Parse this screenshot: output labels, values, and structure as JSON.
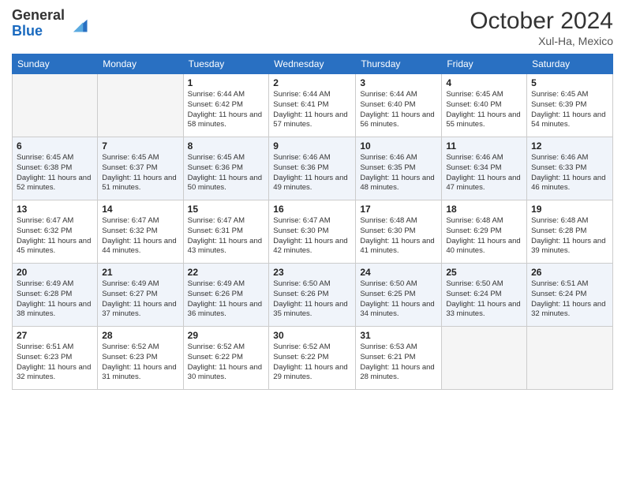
{
  "header": {
    "logo_line1": "General",
    "logo_line2": "Blue",
    "month": "October 2024",
    "location": "Xul-Ha, Mexico"
  },
  "weekdays": [
    "Sunday",
    "Monday",
    "Tuesday",
    "Wednesday",
    "Thursday",
    "Friday",
    "Saturday"
  ],
  "weeks": [
    [
      {
        "day": "",
        "sunrise": "",
        "sunset": "",
        "daylight": "",
        "empty": true
      },
      {
        "day": "",
        "sunrise": "",
        "sunset": "",
        "daylight": "",
        "empty": true
      },
      {
        "day": "1",
        "sunrise": "Sunrise: 6:44 AM",
        "sunset": "Sunset: 6:42 PM",
        "daylight": "Daylight: 11 hours and 58 minutes."
      },
      {
        "day": "2",
        "sunrise": "Sunrise: 6:44 AM",
        "sunset": "Sunset: 6:41 PM",
        "daylight": "Daylight: 11 hours and 57 minutes."
      },
      {
        "day": "3",
        "sunrise": "Sunrise: 6:44 AM",
        "sunset": "Sunset: 6:40 PM",
        "daylight": "Daylight: 11 hours and 56 minutes."
      },
      {
        "day": "4",
        "sunrise": "Sunrise: 6:45 AM",
        "sunset": "Sunset: 6:40 PM",
        "daylight": "Daylight: 11 hours and 55 minutes."
      },
      {
        "day": "5",
        "sunrise": "Sunrise: 6:45 AM",
        "sunset": "Sunset: 6:39 PM",
        "daylight": "Daylight: 11 hours and 54 minutes."
      }
    ],
    [
      {
        "day": "6",
        "sunrise": "Sunrise: 6:45 AM",
        "sunset": "Sunset: 6:38 PM",
        "daylight": "Daylight: 11 hours and 52 minutes."
      },
      {
        "day": "7",
        "sunrise": "Sunrise: 6:45 AM",
        "sunset": "Sunset: 6:37 PM",
        "daylight": "Daylight: 11 hours and 51 minutes."
      },
      {
        "day": "8",
        "sunrise": "Sunrise: 6:45 AM",
        "sunset": "Sunset: 6:36 PM",
        "daylight": "Daylight: 11 hours and 50 minutes."
      },
      {
        "day": "9",
        "sunrise": "Sunrise: 6:46 AM",
        "sunset": "Sunset: 6:36 PM",
        "daylight": "Daylight: 11 hours and 49 minutes."
      },
      {
        "day": "10",
        "sunrise": "Sunrise: 6:46 AM",
        "sunset": "Sunset: 6:35 PM",
        "daylight": "Daylight: 11 hours and 48 minutes."
      },
      {
        "day": "11",
        "sunrise": "Sunrise: 6:46 AM",
        "sunset": "Sunset: 6:34 PM",
        "daylight": "Daylight: 11 hours and 47 minutes."
      },
      {
        "day": "12",
        "sunrise": "Sunrise: 6:46 AM",
        "sunset": "Sunset: 6:33 PM",
        "daylight": "Daylight: 11 hours and 46 minutes."
      }
    ],
    [
      {
        "day": "13",
        "sunrise": "Sunrise: 6:47 AM",
        "sunset": "Sunset: 6:32 PM",
        "daylight": "Daylight: 11 hours and 45 minutes."
      },
      {
        "day": "14",
        "sunrise": "Sunrise: 6:47 AM",
        "sunset": "Sunset: 6:32 PM",
        "daylight": "Daylight: 11 hours and 44 minutes."
      },
      {
        "day": "15",
        "sunrise": "Sunrise: 6:47 AM",
        "sunset": "Sunset: 6:31 PM",
        "daylight": "Daylight: 11 hours and 43 minutes."
      },
      {
        "day": "16",
        "sunrise": "Sunrise: 6:47 AM",
        "sunset": "Sunset: 6:30 PM",
        "daylight": "Daylight: 11 hours and 42 minutes."
      },
      {
        "day": "17",
        "sunrise": "Sunrise: 6:48 AM",
        "sunset": "Sunset: 6:30 PM",
        "daylight": "Daylight: 11 hours and 41 minutes."
      },
      {
        "day": "18",
        "sunrise": "Sunrise: 6:48 AM",
        "sunset": "Sunset: 6:29 PM",
        "daylight": "Daylight: 11 hours and 40 minutes."
      },
      {
        "day": "19",
        "sunrise": "Sunrise: 6:48 AM",
        "sunset": "Sunset: 6:28 PM",
        "daylight": "Daylight: 11 hours and 39 minutes."
      }
    ],
    [
      {
        "day": "20",
        "sunrise": "Sunrise: 6:49 AM",
        "sunset": "Sunset: 6:28 PM",
        "daylight": "Daylight: 11 hours and 38 minutes."
      },
      {
        "day": "21",
        "sunrise": "Sunrise: 6:49 AM",
        "sunset": "Sunset: 6:27 PM",
        "daylight": "Daylight: 11 hours and 37 minutes."
      },
      {
        "day": "22",
        "sunrise": "Sunrise: 6:49 AM",
        "sunset": "Sunset: 6:26 PM",
        "daylight": "Daylight: 11 hours and 36 minutes."
      },
      {
        "day": "23",
        "sunrise": "Sunrise: 6:50 AM",
        "sunset": "Sunset: 6:26 PM",
        "daylight": "Daylight: 11 hours and 35 minutes."
      },
      {
        "day": "24",
        "sunrise": "Sunrise: 6:50 AM",
        "sunset": "Sunset: 6:25 PM",
        "daylight": "Daylight: 11 hours and 34 minutes."
      },
      {
        "day": "25",
        "sunrise": "Sunrise: 6:50 AM",
        "sunset": "Sunset: 6:24 PM",
        "daylight": "Daylight: 11 hours and 33 minutes."
      },
      {
        "day": "26",
        "sunrise": "Sunrise: 6:51 AM",
        "sunset": "Sunset: 6:24 PM",
        "daylight": "Daylight: 11 hours and 32 minutes."
      }
    ],
    [
      {
        "day": "27",
        "sunrise": "Sunrise: 6:51 AM",
        "sunset": "Sunset: 6:23 PM",
        "daylight": "Daylight: 11 hours and 32 minutes."
      },
      {
        "day": "28",
        "sunrise": "Sunrise: 6:52 AM",
        "sunset": "Sunset: 6:23 PM",
        "daylight": "Daylight: 11 hours and 31 minutes."
      },
      {
        "day": "29",
        "sunrise": "Sunrise: 6:52 AM",
        "sunset": "Sunset: 6:22 PM",
        "daylight": "Daylight: 11 hours and 30 minutes."
      },
      {
        "day": "30",
        "sunrise": "Sunrise: 6:52 AM",
        "sunset": "Sunset: 6:22 PM",
        "daylight": "Daylight: 11 hours and 29 minutes."
      },
      {
        "day": "31",
        "sunrise": "Sunrise: 6:53 AM",
        "sunset": "Sunset: 6:21 PM",
        "daylight": "Daylight: 11 hours and 28 minutes."
      },
      {
        "day": "",
        "sunrise": "",
        "sunset": "",
        "daylight": "",
        "empty": true
      },
      {
        "day": "",
        "sunrise": "",
        "sunset": "",
        "daylight": "",
        "empty": true
      }
    ]
  ]
}
